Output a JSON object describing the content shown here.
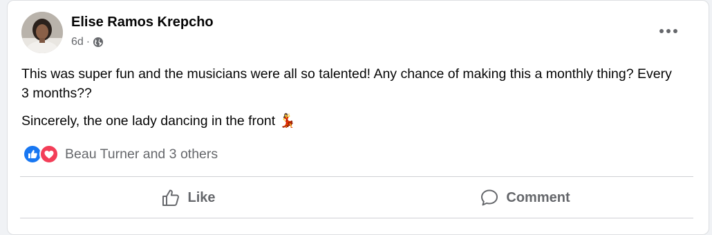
{
  "post": {
    "author": "Elise Ramos Krepcho",
    "time": "6d",
    "separator": "·",
    "audience_icon": "globe-icon",
    "paragraphs": [
      "This was super fun and the musicians were all so talented! Any chance of making this a monthly thing? Every 3 months??",
      "Sincerely, the one lady dancing in the front"
    ],
    "emoji": "💃"
  },
  "reactions": {
    "icons": [
      "like-reaction-icon",
      "love-reaction-icon"
    ],
    "summary": "Beau Turner and 3 others"
  },
  "actions": {
    "like_label": "Like",
    "comment_label": "Comment"
  },
  "colors": {
    "like_blue": "#1877f2",
    "love_red": "#f33e58",
    "secondary_text": "#65676b",
    "primary_text": "#050505"
  }
}
